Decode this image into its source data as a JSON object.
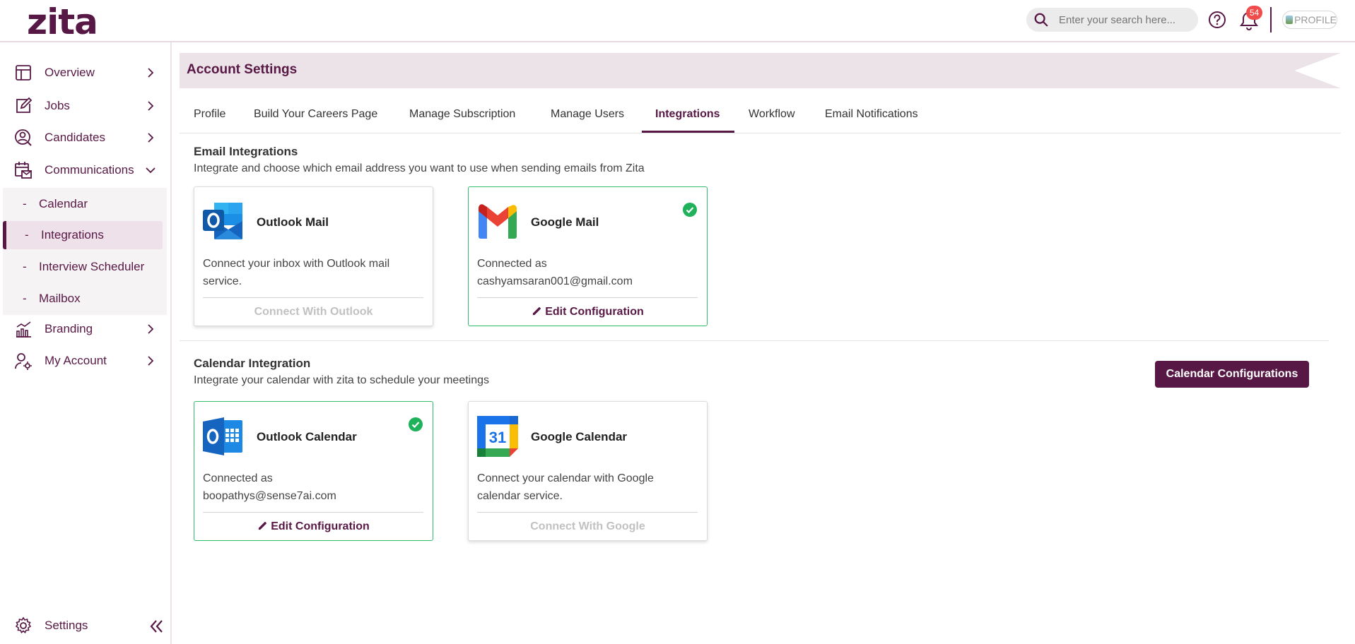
{
  "header": {
    "logo": "zita",
    "search_placeholder": "Enter your search here...",
    "notification_count": "54",
    "profile_label": "PROFILE"
  },
  "sidebar": {
    "items": [
      {
        "label": "Overview",
        "icon": "layout-icon"
      },
      {
        "label": "Jobs",
        "icon": "edit-icon"
      },
      {
        "label": "Candidates",
        "icon": "user-search-icon"
      },
      {
        "label": "Communications",
        "icon": "calendar-mail-icon"
      }
    ],
    "sub_items": [
      {
        "dash": "-",
        "label": "Calendar"
      },
      {
        "dash": "-",
        "label": "Integrations"
      },
      {
        "dash": "-",
        "label": "Interview Scheduler"
      },
      {
        "dash": "-",
        "label": "Mailbox"
      }
    ],
    "items_after": [
      {
        "label": "Branding",
        "icon": "chart-icon"
      },
      {
        "label": "My Account",
        "icon": "user-gear-icon"
      }
    ],
    "settings_label": "Settings"
  },
  "page": {
    "title": "Account Settings",
    "tabs": [
      "Profile",
      "Build Your Careers Page",
      "Manage Subscription",
      "Manage Users",
      "Integrations",
      "Workflow",
      "Email Notifications"
    ],
    "active_tab": "Integrations"
  },
  "email_section": {
    "title": "Email Integrations",
    "description": "Integrate and choose which email address you want to use when sending emails from Zita",
    "cards": [
      {
        "name": "Outlook Mail",
        "desc": "Connect your inbox with Outlook mail service.",
        "action": "Connect With Outlook",
        "connected": false
      },
      {
        "name": "Google Mail",
        "desc_label": "Connected as",
        "email": "cashyamsaran001@gmail.com",
        "action": "Edit Configuration",
        "connected": true
      }
    ]
  },
  "calendar_section": {
    "title": "Calendar Integration",
    "description": "Integrate your calendar with zita to schedule your meetings",
    "button": "Calendar Configurations",
    "cards": [
      {
        "name": "Outlook Calendar",
        "desc_label": "Connected as",
        "email": "boopathys@sense7ai.com",
        "action": "Edit Configuration",
        "connected": true
      },
      {
        "name": "Google Calendar",
        "desc": "Connect your calendar with Google calendar service.",
        "action": "Connect With Google",
        "connected": false,
        "icon_text": "31"
      }
    ]
  },
  "colors": {
    "primary": "#581845",
    "success": "#31bd6a",
    "badge": "#f04c4c"
  }
}
